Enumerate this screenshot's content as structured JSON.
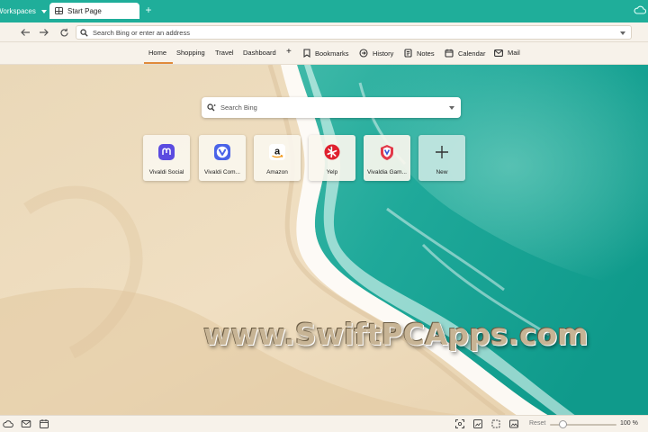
{
  "tabbar": {
    "workspaces_label": "Workspaces",
    "active_tab_title": "Start Page",
    "new_tab_symbol": "+"
  },
  "navbar": {
    "address_placeholder": "Search Bing or enter an address"
  },
  "speed_dial_nav": {
    "groups": [
      "Home",
      "Shopping",
      "Travel",
      "Dashboard"
    ],
    "add_symbol": "+",
    "panels": [
      "Bookmarks",
      "History",
      "Notes",
      "Calendar",
      "Mail"
    ],
    "active_group": "Home"
  },
  "search": {
    "placeholder": "Search Bing"
  },
  "dials": [
    {
      "label": "Vivaldi Social",
      "icon": "mastodon-icon"
    },
    {
      "label": "Vivaldi Com...",
      "icon": "vivaldi-icon"
    },
    {
      "label": "Amazon",
      "icon": "amazon-icon"
    },
    {
      "label": "Yelp",
      "icon": "yelp-icon"
    },
    {
      "label": "Vivaldia Gam...",
      "icon": "vivaldia-game-icon"
    },
    {
      "label": "New",
      "icon": "plus-icon"
    }
  ],
  "watermark": "www.SwiftPCApps.com",
  "statusbar": {
    "reset_label": "Reset",
    "zoom_percent": "100 %",
    "zoom_level": 0.2
  },
  "colors": {
    "accent": "#1fae9a",
    "active_underline": "#e08a3a",
    "chrome_bg": "#f7f2ea"
  }
}
